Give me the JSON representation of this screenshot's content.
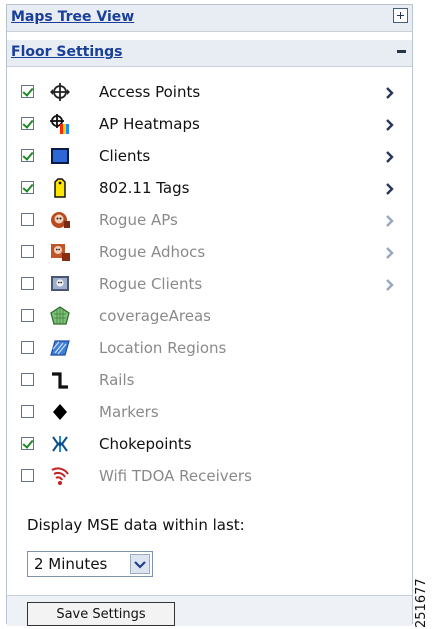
{
  "header": {
    "maps_tree_view": "Maps Tree View",
    "floor_settings": "Floor Settings"
  },
  "layers": [
    {
      "label": "Access Points",
      "checked": true,
      "enabled": true,
      "has_chevron": true,
      "icon": "access-point-icon"
    },
    {
      "label": "AP Heatmaps",
      "checked": true,
      "enabled": true,
      "has_chevron": true,
      "icon": "ap-heatmap-icon"
    },
    {
      "label": "Clients",
      "checked": true,
      "enabled": true,
      "has_chevron": true,
      "icon": "client-icon"
    },
    {
      "label": "802.11 Tags",
      "checked": true,
      "enabled": true,
      "has_chevron": true,
      "icon": "tag-icon"
    },
    {
      "label": "Rogue APs",
      "checked": false,
      "enabled": false,
      "has_chevron": true,
      "icon": "rogue-ap-icon"
    },
    {
      "label": "Rogue Adhocs",
      "checked": false,
      "enabled": false,
      "has_chevron": true,
      "icon": "rogue-adhoc-icon"
    },
    {
      "label": "Rogue Clients",
      "checked": false,
      "enabled": false,
      "has_chevron": true,
      "icon": "rogue-client-icon"
    },
    {
      "label": "coverageAreas",
      "checked": false,
      "enabled": false,
      "has_chevron": false,
      "icon": "coverage-area-icon"
    },
    {
      "label": "Location Regions",
      "checked": false,
      "enabled": false,
      "has_chevron": false,
      "icon": "location-region-icon"
    },
    {
      "label": "Rails",
      "checked": false,
      "enabled": false,
      "has_chevron": false,
      "icon": "rail-icon"
    },
    {
      "label": "Markers",
      "checked": false,
      "enabled": false,
      "has_chevron": false,
      "icon": "marker-icon"
    },
    {
      "label": "Chokepoints",
      "checked": true,
      "enabled": true,
      "has_chevron": false,
      "icon": "chokepoint-icon"
    },
    {
      "label": "Wifi TDOA Receivers",
      "checked": false,
      "enabled": false,
      "has_chevron": false,
      "icon": "wifi-tdoa-receiver-icon"
    }
  ],
  "mse": {
    "label": "Display MSE data within last:",
    "selected": "2 Minutes"
  },
  "save_label": "Save Settings",
  "figure_id": "251677",
  "colors": {
    "header_text": "#1a3f9a",
    "header_bg": "#e8edf3",
    "check": "#1f8a1f",
    "disabled_text": "#8a8a8a"
  }
}
